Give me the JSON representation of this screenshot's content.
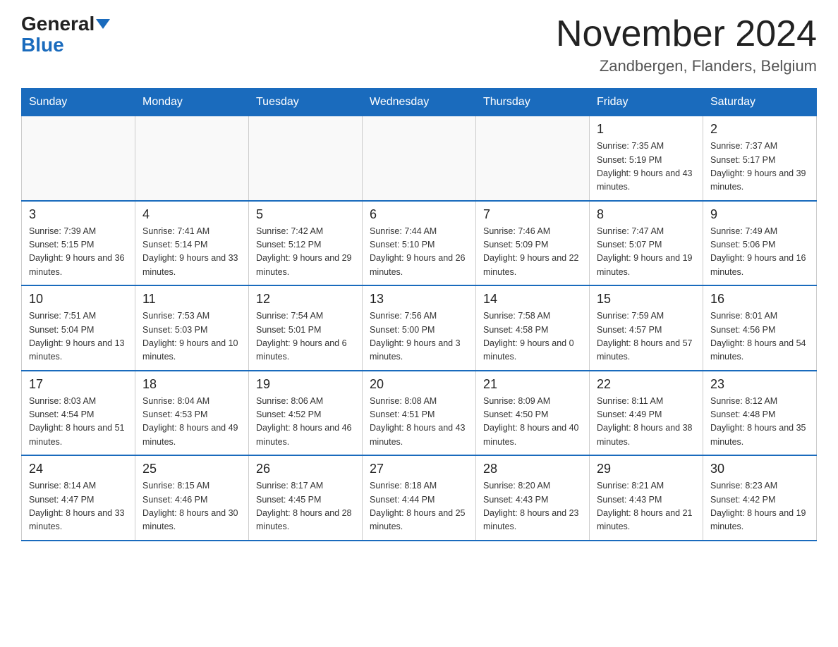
{
  "header": {
    "logo_general": "General",
    "logo_blue": "Blue",
    "month_title": "November 2024",
    "location": "Zandbergen, Flanders, Belgium"
  },
  "weekdays": [
    "Sunday",
    "Monday",
    "Tuesday",
    "Wednesday",
    "Thursday",
    "Friday",
    "Saturday"
  ],
  "weeks": [
    [
      {
        "day": "",
        "sunrise": "",
        "sunset": "",
        "daylight": ""
      },
      {
        "day": "",
        "sunrise": "",
        "sunset": "",
        "daylight": ""
      },
      {
        "day": "",
        "sunrise": "",
        "sunset": "",
        "daylight": ""
      },
      {
        "day": "",
        "sunrise": "",
        "sunset": "",
        "daylight": ""
      },
      {
        "day": "",
        "sunrise": "",
        "sunset": "",
        "daylight": ""
      },
      {
        "day": "1",
        "sunrise": "Sunrise: 7:35 AM",
        "sunset": "Sunset: 5:19 PM",
        "daylight": "Daylight: 9 hours and 43 minutes."
      },
      {
        "day": "2",
        "sunrise": "Sunrise: 7:37 AM",
        "sunset": "Sunset: 5:17 PM",
        "daylight": "Daylight: 9 hours and 39 minutes."
      }
    ],
    [
      {
        "day": "3",
        "sunrise": "Sunrise: 7:39 AM",
        "sunset": "Sunset: 5:15 PM",
        "daylight": "Daylight: 9 hours and 36 minutes."
      },
      {
        "day": "4",
        "sunrise": "Sunrise: 7:41 AM",
        "sunset": "Sunset: 5:14 PM",
        "daylight": "Daylight: 9 hours and 33 minutes."
      },
      {
        "day": "5",
        "sunrise": "Sunrise: 7:42 AM",
        "sunset": "Sunset: 5:12 PM",
        "daylight": "Daylight: 9 hours and 29 minutes."
      },
      {
        "day": "6",
        "sunrise": "Sunrise: 7:44 AM",
        "sunset": "Sunset: 5:10 PM",
        "daylight": "Daylight: 9 hours and 26 minutes."
      },
      {
        "day": "7",
        "sunrise": "Sunrise: 7:46 AM",
        "sunset": "Sunset: 5:09 PM",
        "daylight": "Daylight: 9 hours and 22 minutes."
      },
      {
        "day": "8",
        "sunrise": "Sunrise: 7:47 AM",
        "sunset": "Sunset: 5:07 PM",
        "daylight": "Daylight: 9 hours and 19 minutes."
      },
      {
        "day": "9",
        "sunrise": "Sunrise: 7:49 AM",
        "sunset": "Sunset: 5:06 PM",
        "daylight": "Daylight: 9 hours and 16 minutes."
      }
    ],
    [
      {
        "day": "10",
        "sunrise": "Sunrise: 7:51 AM",
        "sunset": "Sunset: 5:04 PM",
        "daylight": "Daylight: 9 hours and 13 minutes."
      },
      {
        "day": "11",
        "sunrise": "Sunrise: 7:53 AM",
        "sunset": "Sunset: 5:03 PM",
        "daylight": "Daylight: 9 hours and 10 minutes."
      },
      {
        "day": "12",
        "sunrise": "Sunrise: 7:54 AM",
        "sunset": "Sunset: 5:01 PM",
        "daylight": "Daylight: 9 hours and 6 minutes."
      },
      {
        "day": "13",
        "sunrise": "Sunrise: 7:56 AM",
        "sunset": "Sunset: 5:00 PM",
        "daylight": "Daylight: 9 hours and 3 minutes."
      },
      {
        "day": "14",
        "sunrise": "Sunrise: 7:58 AM",
        "sunset": "Sunset: 4:58 PM",
        "daylight": "Daylight: 9 hours and 0 minutes."
      },
      {
        "day": "15",
        "sunrise": "Sunrise: 7:59 AM",
        "sunset": "Sunset: 4:57 PM",
        "daylight": "Daylight: 8 hours and 57 minutes."
      },
      {
        "day": "16",
        "sunrise": "Sunrise: 8:01 AM",
        "sunset": "Sunset: 4:56 PM",
        "daylight": "Daylight: 8 hours and 54 minutes."
      }
    ],
    [
      {
        "day": "17",
        "sunrise": "Sunrise: 8:03 AM",
        "sunset": "Sunset: 4:54 PM",
        "daylight": "Daylight: 8 hours and 51 minutes."
      },
      {
        "day": "18",
        "sunrise": "Sunrise: 8:04 AM",
        "sunset": "Sunset: 4:53 PM",
        "daylight": "Daylight: 8 hours and 49 minutes."
      },
      {
        "day": "19",
        "sunrise": "Sunrise: 8:06 AM",
        "sunset": "Sunset: 4:52 PM",
        "daylight": "Daylight: 8 hours and 46 minutes."
      },
      {
        "day": "20",
        "sunrise": "Sunrise: 8:08 AM",
        "sunset": "Sunset: 4:51 PM",
        "daylight": "Daylight: 8 hours and 43 minutes."
      },
      {
        "day": "21",
        "sunrise": "Sunrise: 8:09 AM",
        "sunset": "Sunset: 4:50 PM",
        "daylight": "Daylight: 8 hours and 40 minutes."
      },
      {
        "day": "22",
        "sunrise": "Sunrise: 8:11 AM",
        "sunset": "Sunset: 4:49 PM",
        "daylight": "Daylight: 8 hours and 38 minutes."
      },
      {
        "day": "23",
        "sunrise": "Sunrise: 8:12 AM",
        "sunset": "Sunset: 4:48 PM",
        "daylight": "Daylight: 8 hours and 35 minutes."
      }
    ],
    [
      {
        "day": "24",
        "sunrise": "Sunrise: 8:14 AM",
        "sunset": "Sunset: 4:47 PM",
        "daylight": "Daylight: 8 hours and 33 minutes."
      },
      {
        "day": "25",
        "sunrise": "Sunrise: 8:15 AM",
        "sunset": "Sunset: 4:46 PM",
        "daylight": "Daylight: 8 hours and 30 minutes."
      },
      {
        "day": "26",
        "sunrise": "Sunrise: 8:17 AM",
        "sunset": "Sunset: 4:45 PM",
        "daylight": "Daylight: 8 hours and 28 minutes."
      },
      {
        "day": "27",
        "sunrise": "Sunrise: 8:18 AM",
        "sunset": "Sunset: 4:44 PM",
        "daylight": "Daylight: 8 hours and 25 minutes."
      },
      {
        "day": "28",
        "sunrise": "Sunrise: 8:20 AM",
        "sunset": "Sunset: 4:43 PM",
        "daylight": "Daylight: 8 hours and 23 minutes."
      },
      {
        "day": "29",
        "sunrise": "Sunrise: 8:21 AM",
        "sunset": "Sunset: 4:43 PM",
        "daylight": "Daylight: 8 hours and 21 minutes."
      },
      {
        "day": "30",
        "sunrise": "Sunrise: 8:23 AM",
        "sunset": "Sunset: 4:42 PM",
        "daylight": "Daylight: 8 hours and 19 minutes."
      }
    ]
  ]
}
